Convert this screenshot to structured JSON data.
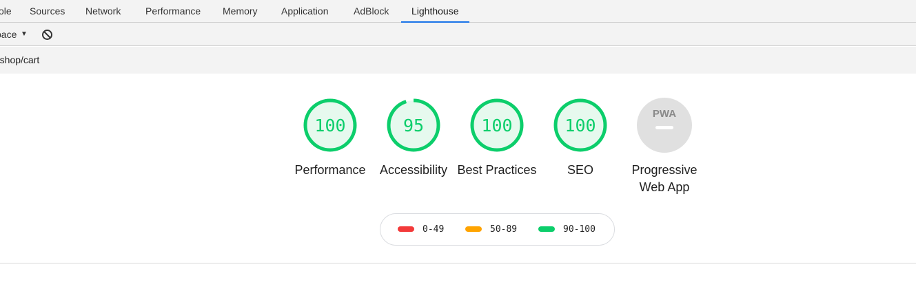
{
  "tabs": [
    {
      "label": "ole",
      "active": false
    },
    {
      "label": "Sources",
      "active": false
    },
    {
      "label": "Network",
      "active": false
    },
    {
      "label": "Performance",
      "active": false
    },
    {
      "label": "Memory",
      "active": false
    },
    {
      "label": "Application",
      "active": false
    },
    {
      "label": "AdBlock",
      "active": false
    },
    {
      "label": "Lighthouse",
      "active": true
    }
  ],
  "toolbar": {
    "dropdown_label": "pace",
    "dropdown_arrow": "▼",
    "clear_icon": "block-icon"
  },
  "url": "e/shop/cart",
  "gauges": [
    {
      "score": "100",
      "value": 100,
      "label": "Performance",
      "kind": "score"
    },
    {
      "score": "95",
      "value": 95,
      "label": "Accessibility",
      "kind": "score"
    },
    {
      "score": "100",
      "value": 100,
      "label": "Best Practices",
      "kind": "score"
    },
    {
      "score": "100",
      "value": 100,
      "label": "SEO",
      "kind": "score"
    },
    {
      "score": "",
      "value": null,
      "label": "Progressive Web App",
      "kind": "pwa",
      "badge_text": "PWA"
    }
  ],
  "legend": [
    {
      "range": "0-49",
      "color": "#f33a3a"
    },
    {
      "range": "50-89",
      "color": "#ffa400"
    },
    {
      "range": "90-100",
      "color": "#0cce6b"
    }
  ],
  "colors": {
    "pass": "#0cce6b",
    "pass_fill": "#e6f9ee",
    "pwa_fill": "#e0e0e0",
    "tab_accent": "#1a73e8"
  }
}
